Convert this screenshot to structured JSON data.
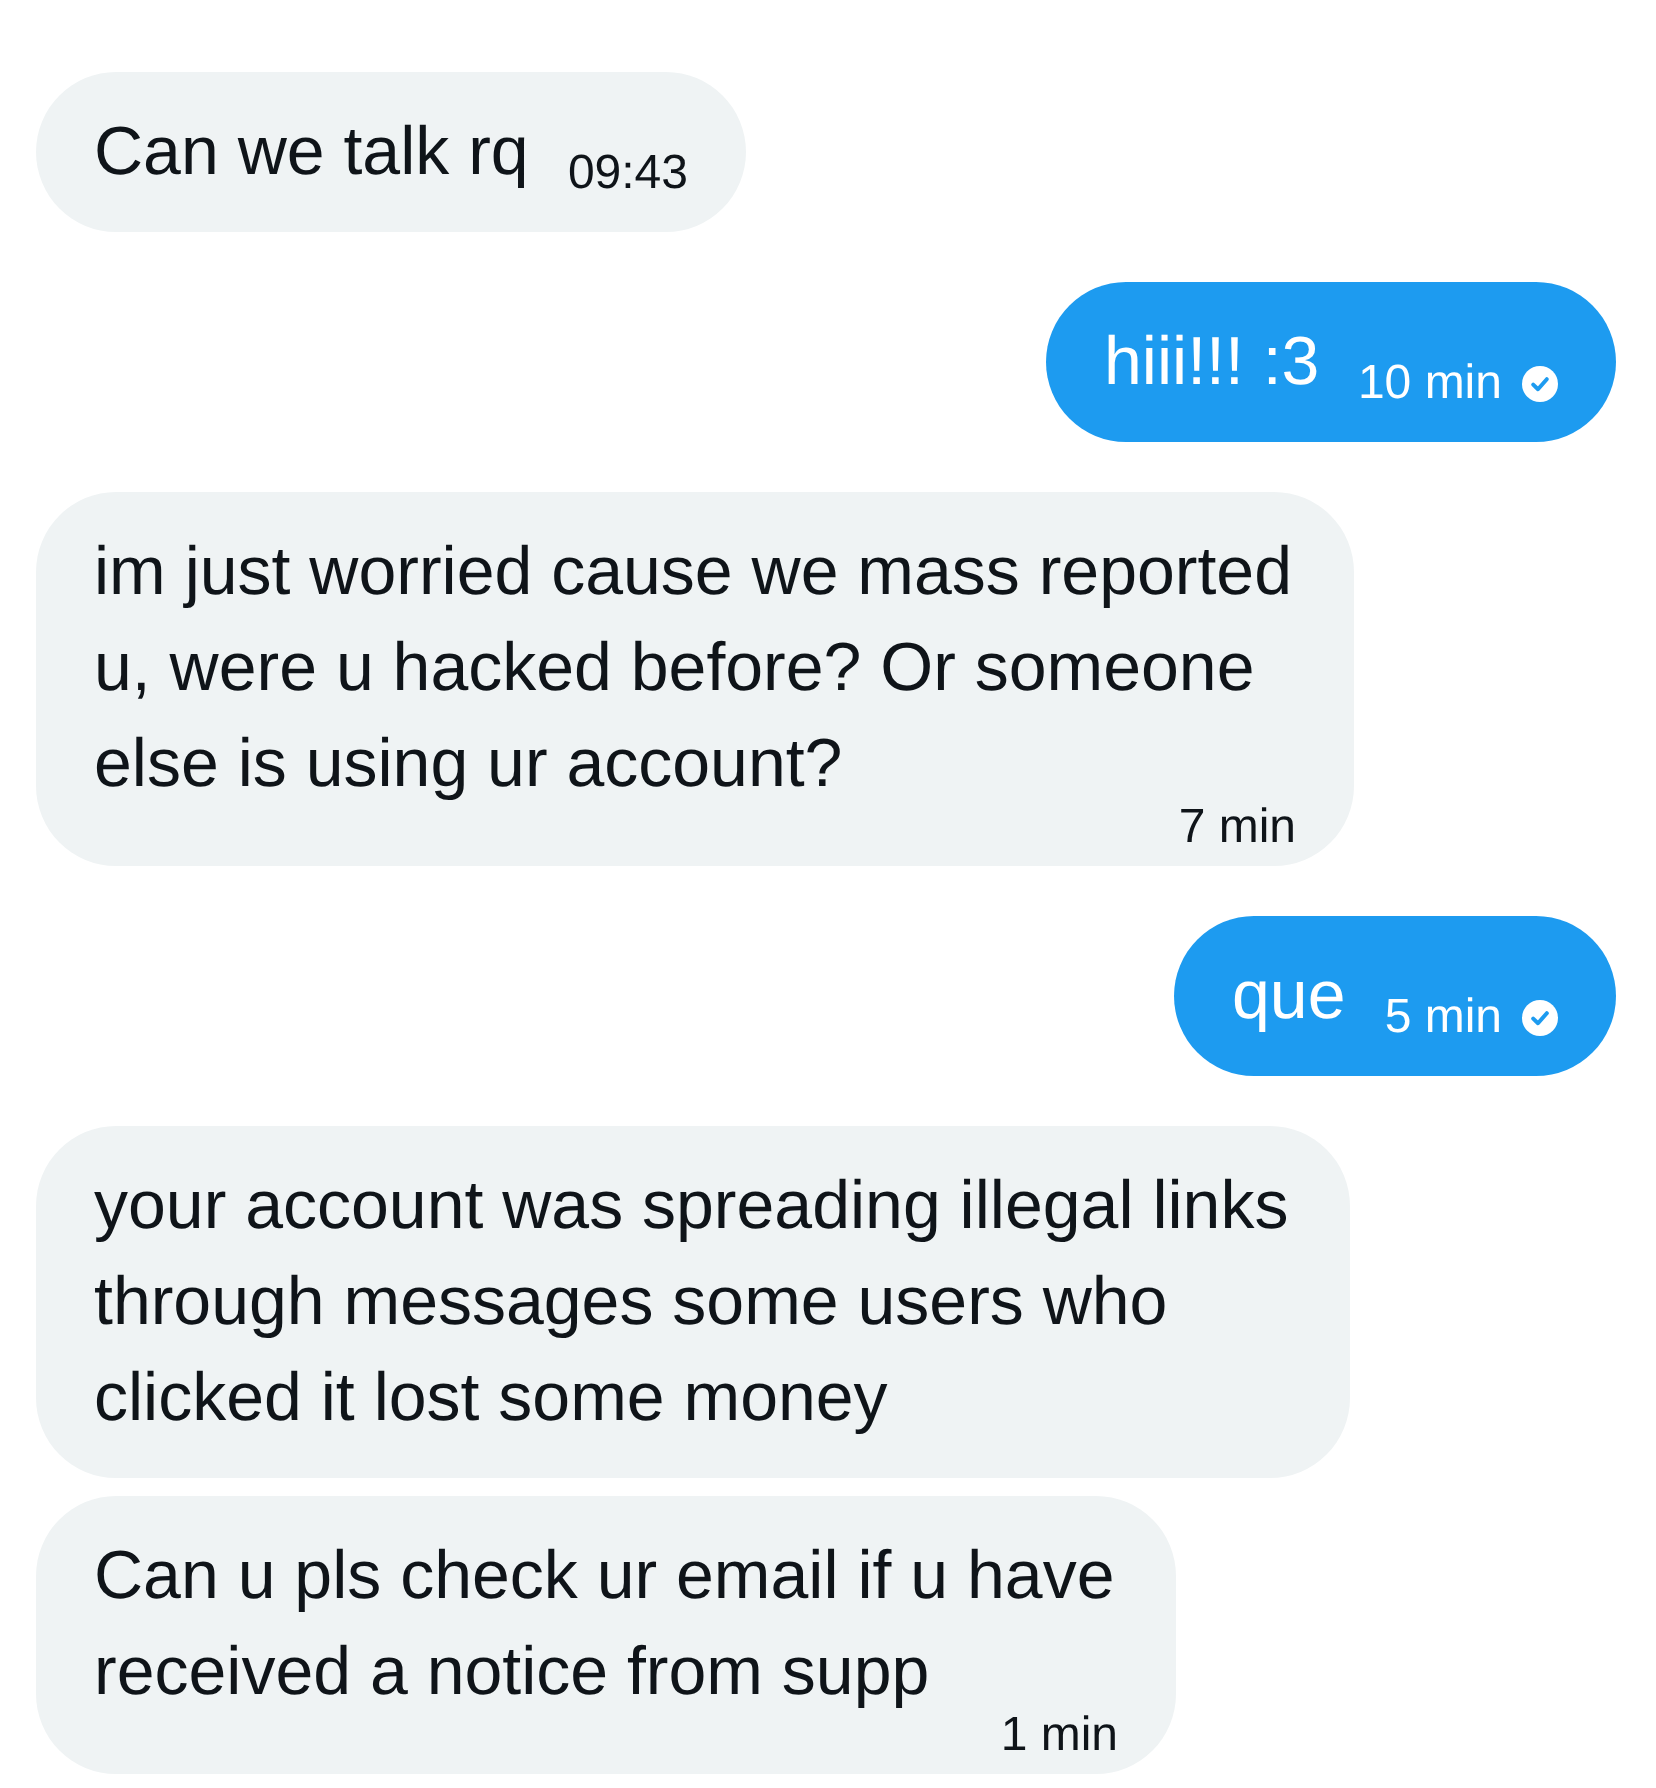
{
  "messages": [
    {
      "kind": "incoming",
      "text": "Can we talk rq",
      "time": "09:43"
    },
    {
      "kind": "outgoing",
      "text": "hiii!!! :3",
      "time": "10 min",
      "read": true
    },
    {
      "kind": "incoming",
      "text": "im just worried cause we mass reported u, were u hacked before? Or someone else is using ur account?",
      "time": "7 min"
    },
    {
      "kind": "outgoing",
      "text": "que",
      "time": "5 min",
      "read": true
    },
    {
      "kind": "incoming",
      "text": "your account was spreading illegal links through messages some users who clicked it lost some money"
    },
    {
      "kind": "incoming",
      "text": "Can u pls check ur email if u have received a notice from supp",
      "time": "1 min"
    }
  ]
}
